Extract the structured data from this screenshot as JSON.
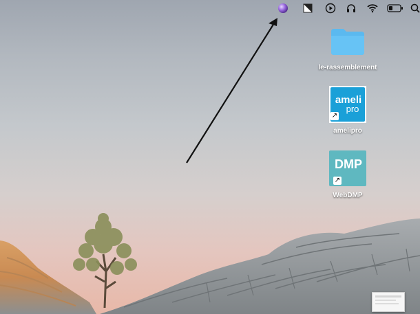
{
  "menubar": {
    "items": [
      {
        "icon": "purple-orb-icon"
      },
      {
        "icon": "dark-mode-toggle-icon"
      },
      {
        "icon": "play-circle-icon"
      },
      {
        "icon": "headphones-icon"
      },
      {
        "icon": "wifi-icon"
      },
      {
        "icon": "battery-icon"
      },
      {
        "icon": "search-icon"
      }
    ]
  },
  "desktop": {
    "icons": [
      {
        "label": "le-rassemblement",
        "type": "folder",
        "color": "#5bb9ef"
      },
      {
        "label": "amelipro",
        "type": "app-alias",
        "color": "#1aa0d8",
        "logo_text_top": "ameli",
        "logo_text_bottom": "pro"
      },
      {
        "label": "WebDMP",
        "type": "app-alias",
        "color": "#5fb8c0",
        "logo_text": "DMP"
      }
    ]
  },
  "annotation": {
    "type": "arrow",
    "color": "#111111",
    "target": "purple-orb-icon"
  },
  "colors": {
    "folder": "#5bb9ef",
    "amelipro": "#1aa0d8",
    "webdmp": "#5fb8c0",
    "rock": "#9aa0a4"
  }
}
